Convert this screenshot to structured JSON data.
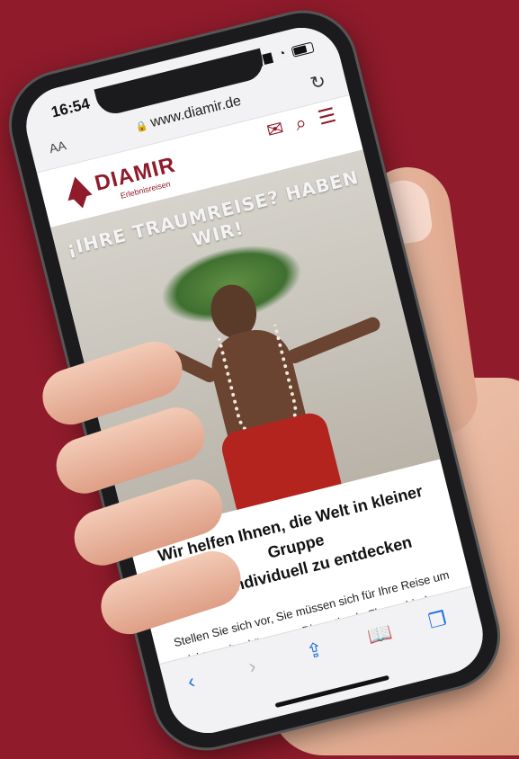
{
  "status": {
    "time": "16:54"
  },
  "browser": {
    "text_size": "AA",
    "url": "www.diamir.de"
  },
  "site": {
    "logo": "DIAMIR",
    "logo_sub": "Erlebnisreisen",
    "hero_title": "¡IHRE TRAUMREISE? HABEN WIR!",
    "headline_1": "Wir helfen Ihnen, die Welt in kleiner Gruppe",
    "headline_2": "oder individuell zu entdecken",
    "paragraph_1": "Stellen Sie sich vor, Sie müssen sich für Ihre Reise um",
    "paragraph_2": "nichts weiter kümmern. Die optimale Flugverbindung,"
  },
  "colors": {
    "brand": "#8f1b2b",
    "background": "#8f1b2b",
    "ios_blue": "#1a6fe0"
  },
  "icons": [
    "signal-icon",
    "wifi-icon",
    "battery-icon",
    "lock-icon",
    "reload-icon",
    "mail-icon",
    "search-icon",
    "menu-icon",
    "back-icon",
    "forward-icon",
    "share-icon",
    "bookmarks-icon",
    "tabs-icon"
  ]
}
